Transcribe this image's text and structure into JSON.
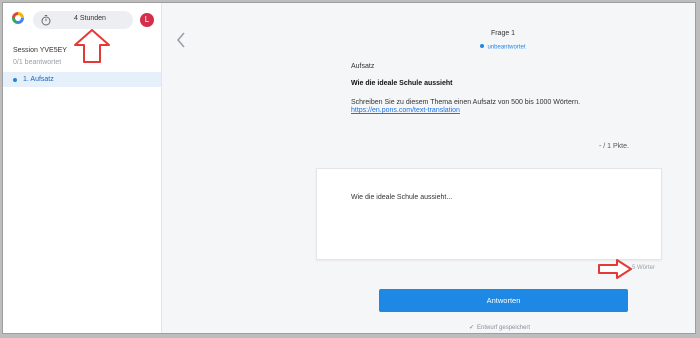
{
  "sidebar": {
    "timer_text": "4 Stunden",
    "avatar_letter": "L",
    "session_title": "Session YVE5EY",
    "session_progress": "0/1 beantwortet",
    "items": [
      {
        "label": "1. Aufsatz",
        "active": true
      }
    ]
  },
  "question": {
    "title": "Frage 1",
    "status": "unbeantwortet",
    "task_type": "Aufsatz",
    "task_title": "Wie die ideale Schule aussieht",
    "description": "Schreiben Sie zu diesem Thema einen Aufsatz von 500 bis 1000 Wörtern.",
    "link": "https://en.pons.com/text-translation",
    "points": "- / 1 Pkte."
  },
  "answer": {
    "text": "Wie die ideale Schule aussieht...",
    "word_count": "5 Wörter"
  },
  "actions": {
    "submit_label": "Antworten",
    "draft_status": "Entwurf gespeichert"
  },
  "colors": {
    "accent": "#1e88e5",
    "annotation_arrow": "#e53935",
    "avatar": "#d32f4a"
  },
  "icons": {
    "logo": "app-logo-icon",
    "timer": "stopwatch-icon",
    "back": "chevron-left-icon",
    "draft": "checkmark-icon",
    "annotations": [
      "annotation-arrow-up-icon",
      "annotation-arrow-right-icon"
    ]
  }
}
